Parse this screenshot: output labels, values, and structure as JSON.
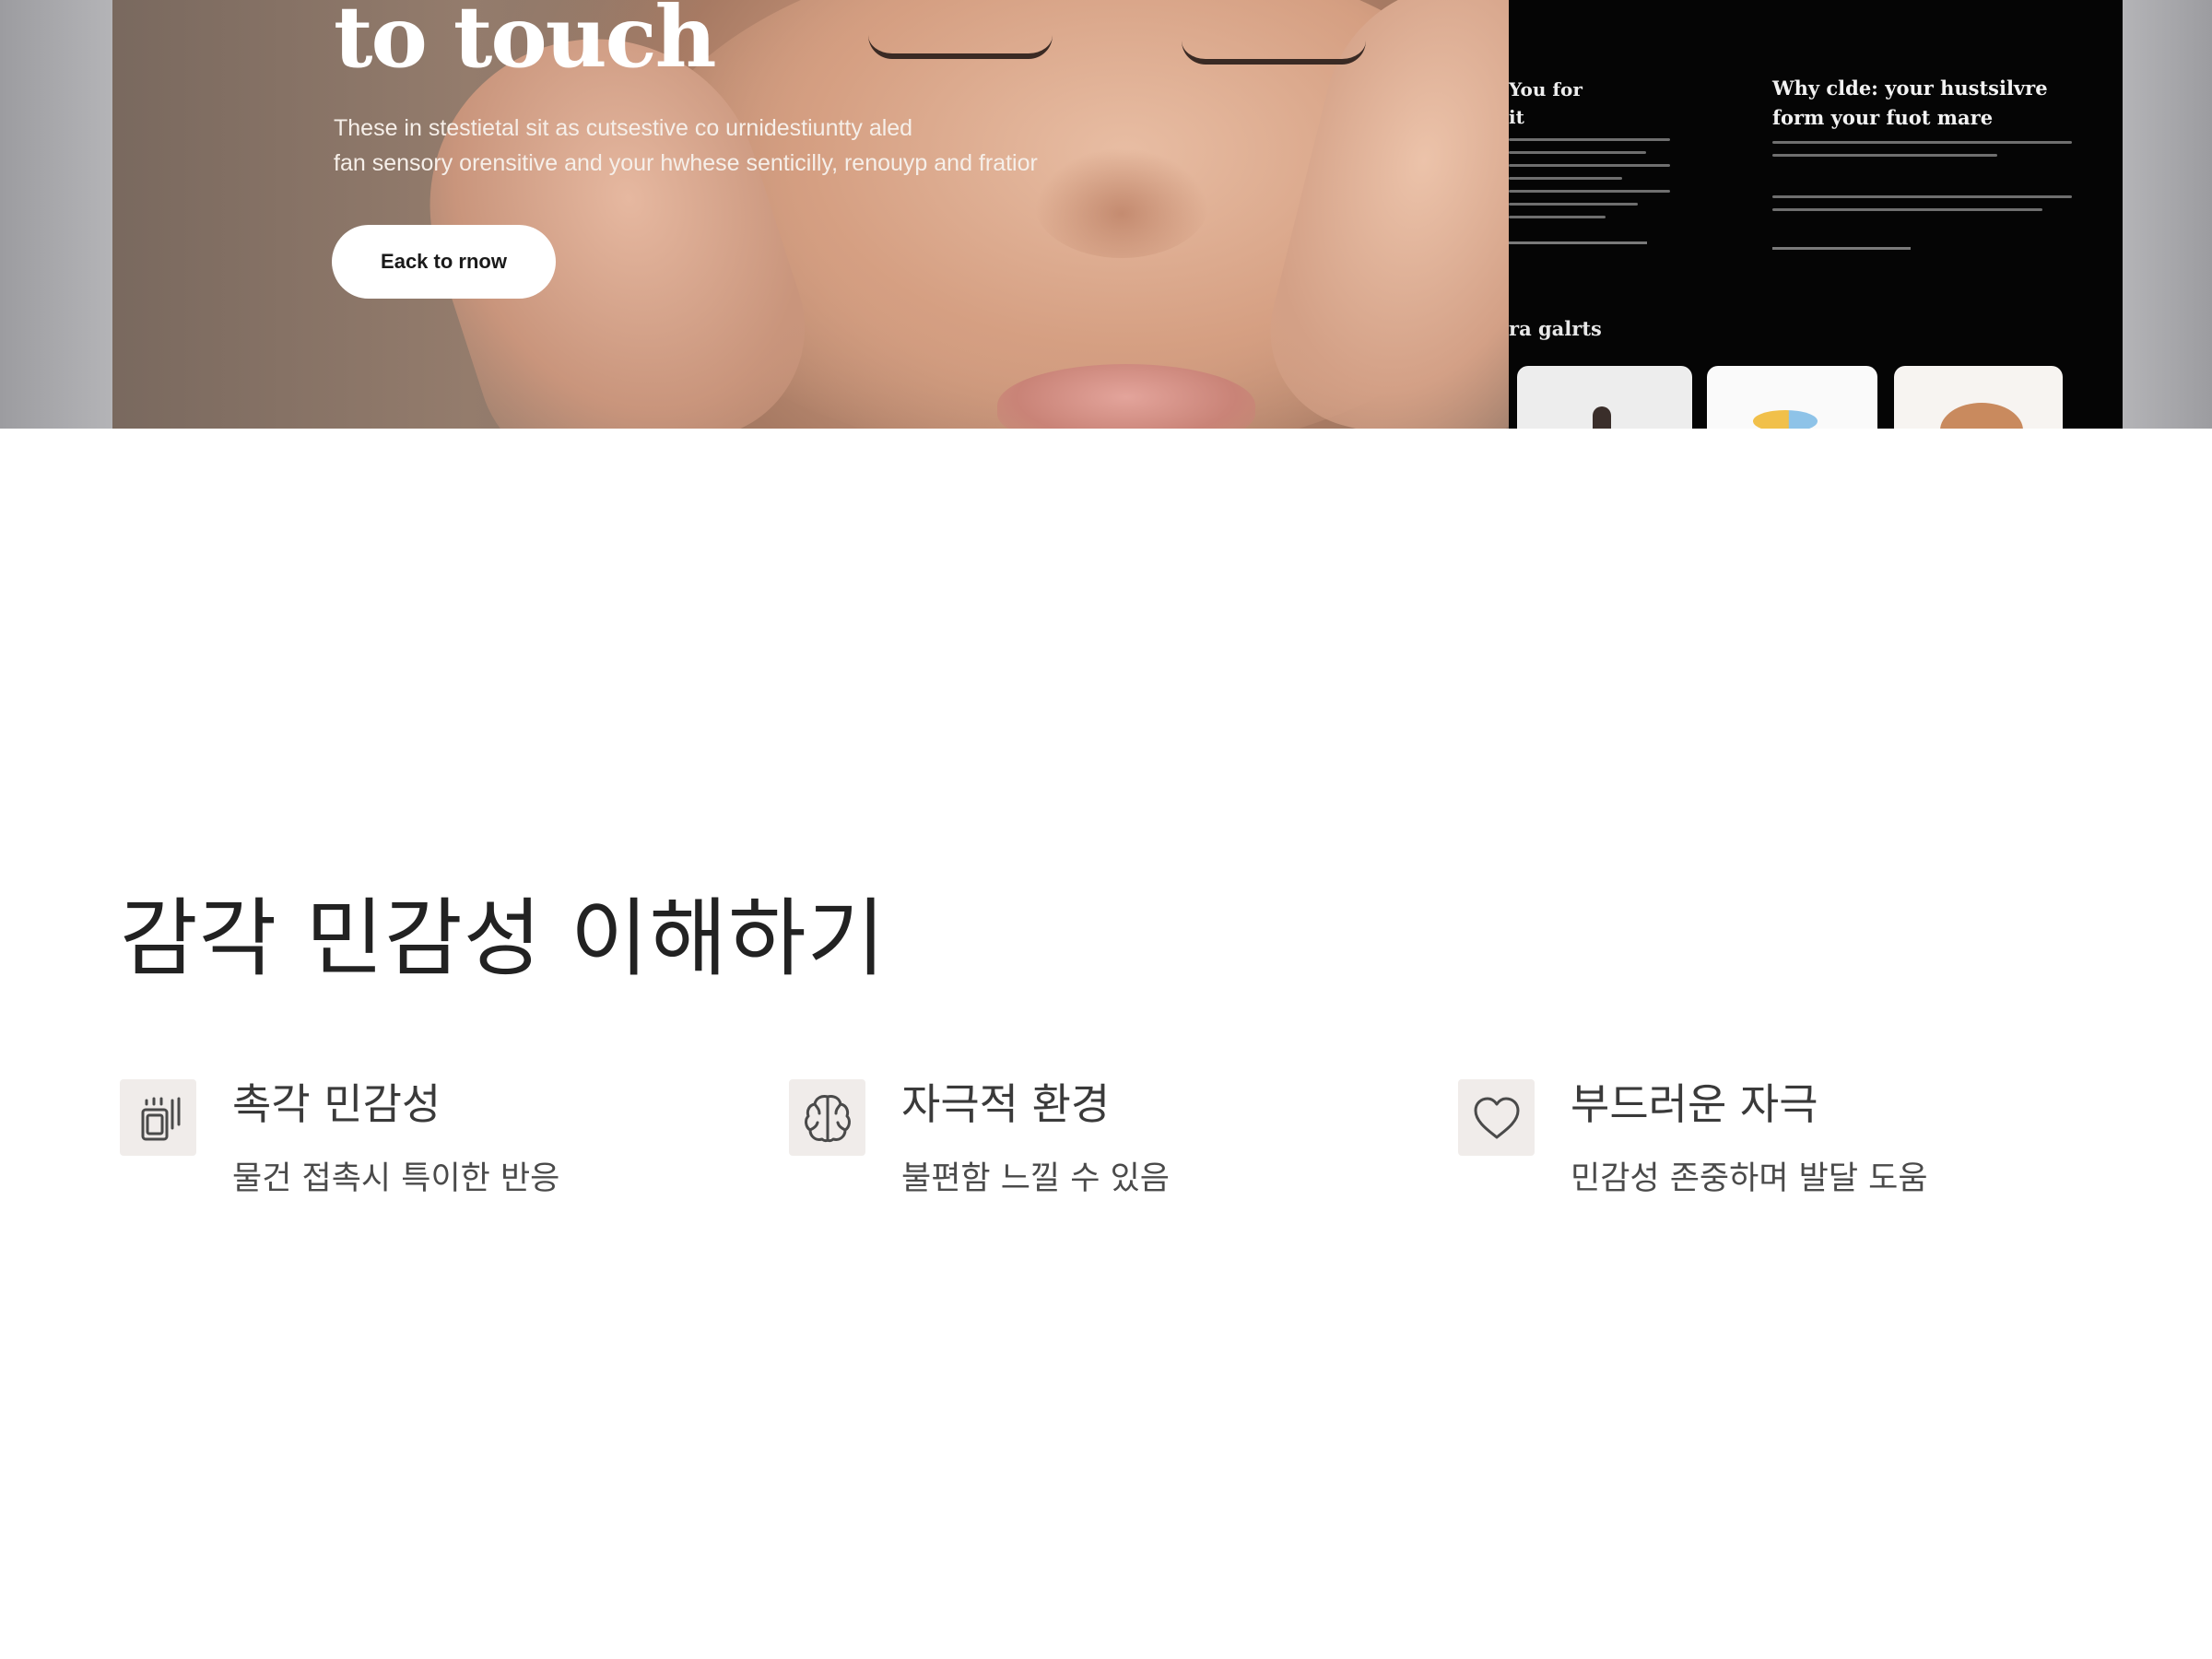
{
  "hero": {
    "title": "to touch",
    "subtitle_line_1": "These in stestietal sit as cutsestive co urnidestiuntty aled",
    "subtitle_line_2": "fan sensory orensitive and your hwhese senticilly, renouyp and fratior",
    "button_label": "Eack to rnow",
    "colors": {
      "panel_background": "#050505",
      "button_background": "#ffffff"
    }
  },
  "side_panel": {
    "column_a_title": "You for\nit",
    "column_b_title": "Why clde: your hustsilvre\nform your fuot mare",
    "gallery_label": "ra galrts"
  },
  "section": {
    "title": "감각 민감성 이해하기",
    "features": [
      {
        "icon": "touch-device-icon",
        "title": "촉각 민감성",
        "description": "물건 접촉시 특이한 반응"
      },
      {
        "icon": "brain-icon",
        "title": "자극적 환경",
        "description": "불편함 느낄 수 있음"
      },
      {
        "icon": "heart-icon",
        "title": "부드러운 자극",
        "description": "민감성 존중하며 발달 도움"
      }
    ],
    "colors": {
      "icon_background": "#f0ecea",
      "title_text": "#222222"
    }
  }
}
